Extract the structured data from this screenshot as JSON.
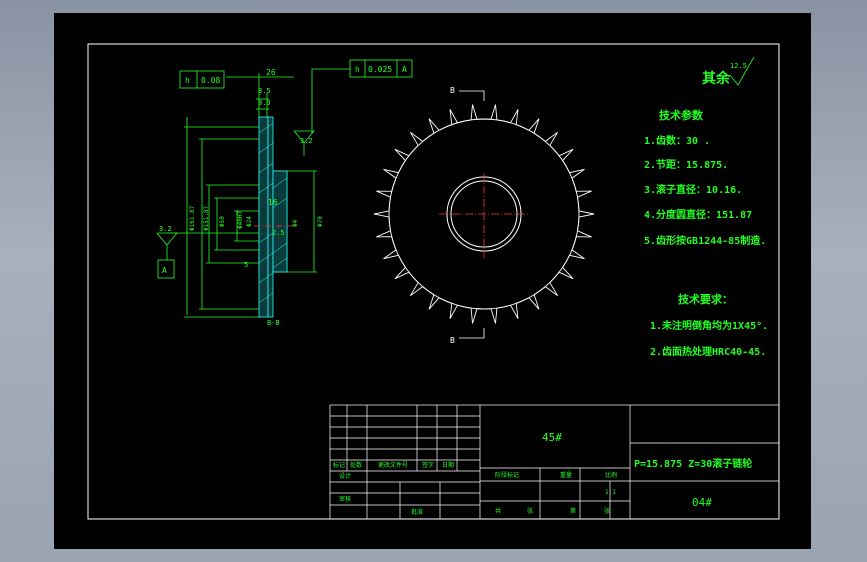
{
  "title_block": {
    "material": "45#",
    "drawing_title": "P=15.875  Z=30滚子链轮",
    "drawing_number": "04#",
    "scale": "1:1",
    "header_cells": [
      "标记",
      "处数",
      "更改文件号",
      "签字",
      "日期"
    ],
    "row_labels": [
      "设计",
      "审核",
      "批准"
    ],
    "stage_cells": [
      "阶段标记",
      "重量",
      "比例"
    ],
    "sheet_cells": [
      "共",
      "张",
      "第",
      "张"
    ]
  },
  "roughness": {
    "label": "其余",
    "value": "12.5"
  },
  "tech_params": {
    "heading": "技术参数",
    "items": [
      "1.齿数：30 .",
      "2.节距：15.875.",
      "3.滚子直径：10.16.",
      "4.分度圆直径：151.87",
      "5.齿形按GB1244-85制造."
    ]
  },
  "tech_requirements": {
    "heading": "技术要求：",
    "items": [
      "1.未注明倒角均为1X45°.",
      "2.齿面热处理HRC40-45."
    ]
  },
  "section_view": {
    "tolerance_left": {
      "symbol": "h",
      "value": "0.08"
    },
    "tolerance_top": {
      "symbol": "h",
      "value": "0.025",
      "datum": "A"
    },
    "datum_left": "A",
    "section_label": "B-B",
    "dim_top": "26",
    "dim_a": "8.5",
    "dim_b": "8.9",
    "dim_hub": "16",
    "dim_small": "5",
    "dim_r": "2.5",
    "roughness_a": "3.2",
    "roughness_b": "3.2",
    "dia_labels": [
      "Φ161.87",
      "Φ151.87",
      "Φ50",
      "Φ40H7",
      "Φ24"
    ],
    "dia_right": "Φ70",
    "dia_small": "Φ4"
  },
  "front_view": {
    "mark_top": "B",
    "mark_bottom": "B"
  }
}
